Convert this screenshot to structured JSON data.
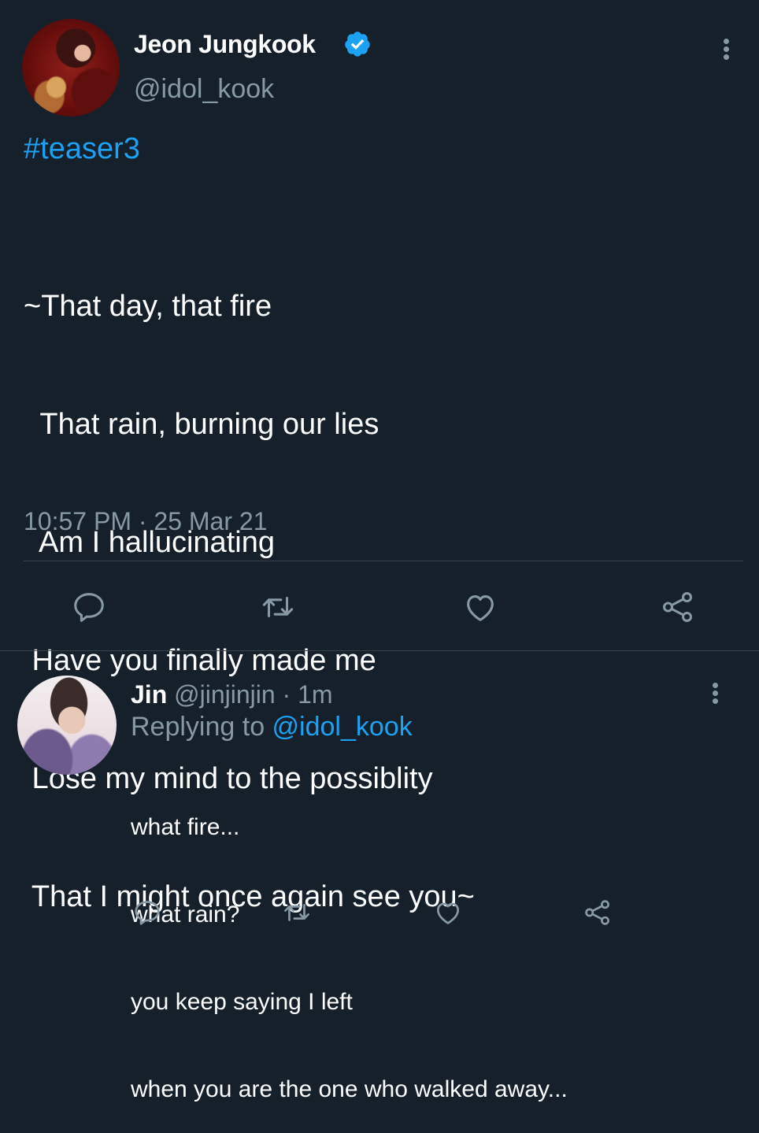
{
  "tweet": {
    "display_name": "Jeon Jungkook",
    "handle": "@idol_kook",
    "verified_icon": "verified-badge-icon",
    "hashtag": "#teaser3",
    "lines": [
      "~That day, that fire",
      "  That rain, burning our lies",
      "  Am I hallucinating",
      " Have you finally made me",
      " Lose my mind to the possiblity",
      " That I might once again see you~"
    ],
    "timestamp": "10:57 PM · 25 Mar 21",
    "actions": [
      "reply-icon",
      "retweet-icon",
      "like-icon",
      "share-icon"
    ]
  },
  "reply": {
    "display_name": "Jin",
    "meta": " @jinjinjin · 1m",
    "replying_prefix": "Replying to ",
    "replying_to": "@idol_kook",
    "lines": [
      "what fire...",
      "what rain?",
      "you keep saying I left",
      "when you are the one who walked away..."
    ],
    "actions": [
      "reply-icon",
      "retweet-icon",
      "like-icon",
      "share-icon"
    ]
  },
  "colors": {
    "background": "#15202b",
    "accent": "#1da1f2",
    "secondary_text": "#8899a6",
    "divider": "#38444d"
  }
}
